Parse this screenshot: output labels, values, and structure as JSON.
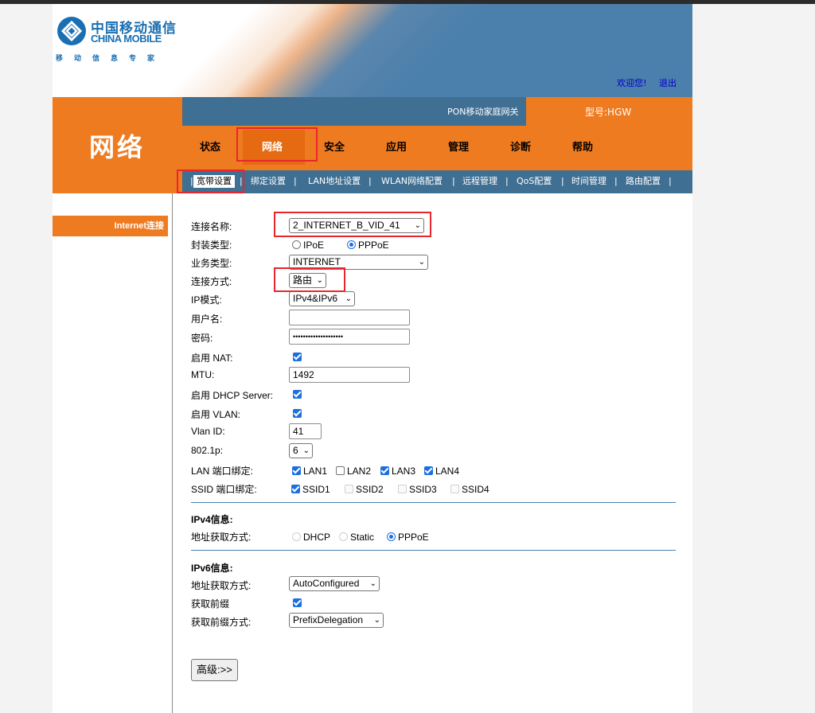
{
  "logo": {
    "cn": "中国移动通信",
    "en": "CHINA MOBILE",
    "sub": "移动信息专家"
  },
  "header": {
    "welcome": "欢迎您!",
    "logout": "退出",
    "product": "PON移动家庭网关",
    "model": "型号:HGW"
  },
  "section_title": "网络",
  "main_nav": [
    "状态",
    "网络",
    "安全",
    "应用",
    "管理",
    "诊断",
    "帮助"
  ],
  "sub_nav": [
    "宽带设置",
    "绑定设置",
    "LAN地址设置",
    "WLAN网络配置",
    "远程管理",
    "QoS配置",
    "时间管理",
    "路由配置"
  ],
  "sidebar": {
    "item": "Internet连接"
  },
  "form": {
    "conn_name_label": "连接名称:",
    "conn_name_value": "2_INTERNET_B_VID_41",
    "encap_label": "封装类型:",
    "encap_ipoe": "IPoE",
    "encap_pppoe": "PPPoE",
    "service_label": "业务类型:",
    "service_value": "INTERNET",
    "mode_label": "连接方式:",
    "mode_value": "路由",
    "ipmode_label": "IP模式:",
    "ipmode_value": "IPv4&IPv6",
    "user_label": "用户名:",
    "user_value": "",
    "pass_label": "密码:",
    "pass_value": "••••••••••••••••••••",
    "nat_label": "启用 NAT:",
    "mtu_label": "MTU:",
    "mtu_value": "1492",
    "dhcp_label": "启用 DHCP Server:",
    "vlan_label": "启用 VLAN:",
    "vlanid_label": "Vlan ID:",
    "vlanid_value": "41",
    "p8021_label": "802.1p:",
    "p8021_value": "6",
    "lan_bind_label": "LAN 端口绑定:",
    "lan_ports": [
      "LAN1",
      "LAN2",
      "LAN3",
      "LAN4"
    ],
    "ssid_bind_label": "SSID 端口绑定:",
    "ssids": [
      "SSID1",
      "SSID2",
      "SSID3",
      "SSID4"
    ]
  },
  "ipv4": {
    "title": "IPv4信息:",
    "method_label": "地址获取方式:",
    "options": [
      "DHCP",
      "Static",
      "PPPoE"
    ]
  },
  "ipv6": {
    "title": "IPv6信息:",
    "method_label": "地址获取方式:",
    "method_value": "AutoConfigured",
    "prefix_label": "获取前缀",
    "prefix_method_label": "获取前缀方式:",
    "prefix_method_value": "PrefixDelegation"
  },
  "advanced_button": "高级:>>",
  "colors": {
    "orange": "#ef7b21",
    "blue": "#3f6f93",
    "highlight": "#e8262d",
    "check": "#1b6fe0"
  }
}
